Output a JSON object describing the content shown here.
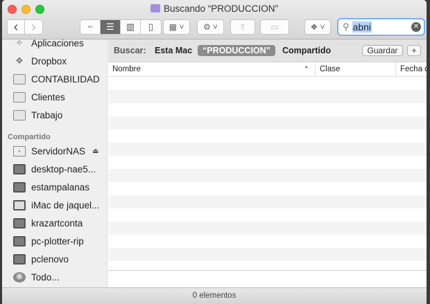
{
  "window": {
    "title": "Buscando “PRODUCCION”"
  },
  "toolbar": {
    "back": "‹",
    "forward": "›",
    "search_value": "abni",
    "search_icon": "magnifier-icon",
    "clear_icon": "clear-icon"
  },
  "sidebar": {
    "favorites": [
      {
        "label": "Aplicaciones",
        "icon": "applications-icon"
      },
      {
        "label": "Dropbox",
        "icon": "dropbox-icon"
      },
      {
        "label": "CONTABILIDAD",
        "icon": "folder-icon"
      },
      {
        "label": "Clientes",
        "icon": "folder-icon"
      },
      {
        "label": "Trabajo",
        "icon": "folder-icon"
      }
    ],
    "shared_header": "Compartido",
    "shared": [
      {
        "label": "ServidorNAS",
        "icon": "server-icon"
      },
      {
        "label": "desktop-nae5...",
        "icon": "monitor-icon"
      },
      {
        "label": "estampalanas",
        "icon": "monitor-icon"
      },
      {
        "label": "iMac de jaquel...",
        "icon": "imac-icon"
      },
      {
        "label": "krazartconta",
        "icon": "monitor-icon"
      },
      {
        "label": "pc-plotter-rip",
        "icon": "monitor-icon"
      },
      {
        "label": "pclenovo",
        "icon": "monitor-icon"
      },
      {
        "label": "Todo...",
        "icon": "network-icon"
      }
    ]
  },
  "scope": {
    "label": "Buscar:",
    "options": [
      "Esta Mac",
      "“PRODUCCION”",
      "Compartido"
    ],
    "selected": "“PRODUCCION”",
    "save": "Guardar",
    "add": "+"
  },
  "columns": [
    {
      "label": "Nombre",
      "sort": "ascending"
    },
    {
      "label": "Clase"
    },
    {
      "label": "Fecha d"
    }
  ],
  "status": "0 elementos"
}
